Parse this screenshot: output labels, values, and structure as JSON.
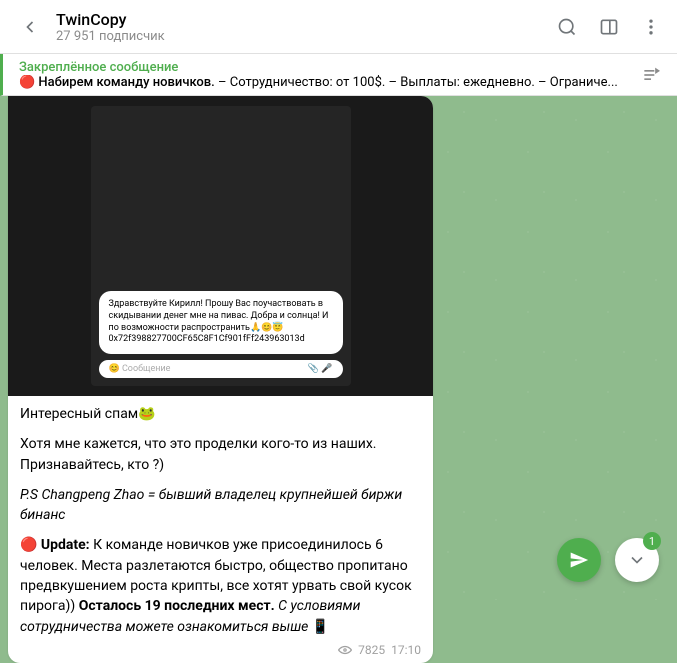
{
  "header": {
    "channel_name": "TwinCopy",
    "subscribers": "27 951 подписчик"
  },
  "pinned": {
    "title": "Закреплённое сообщение",
    "bold": "🔴 Набирем команду новичков.",
    "rest": "  – Сотрудничество: от 100$. – Выплаты: ежедневно. – Ограниче..."
  },
  "inner_screenshot": {
    "bubble_text": "Здравствуйте Кирилл! Прошу Вас поучаствовать в скидывании денег мне на пивас. Добра и солнца! И по возможности распространить🙏😊😇 0x72f398827700CF65C8F1Cf901fFf243963013d",
    "input_placeholder": "Сообщение"
  },
  "message": {
    "p1": "Интересный спам🐸",
    "p2": "Хотя мне кажется, что это проделки кого-то из наших. Признавайтесь, кто ?)",
    "p3": "P.S Changpeng Zhao = бывший владелец крупнейшей биржи бинанс",
    "p4_prefix": "🔴 ",
    "p4_bold1": "Update:",
    "p4_mid": " К команде новичков уже присоединилось 6 человек. Места разлетаются быстро, общество пропитано предвкушением роста крипты, все хотят урвать свой кусок пирога)) ",
    "p4_bold2": "Осталось 19 последних мест.",
    "p4_italic": " С условиями сотрудничества можете ознакомиться выше",
    "p4_suffix": " 📱",
    "views": "7825",
    "time": "17:10"
  },
  "scroll_badge": "1"
}
